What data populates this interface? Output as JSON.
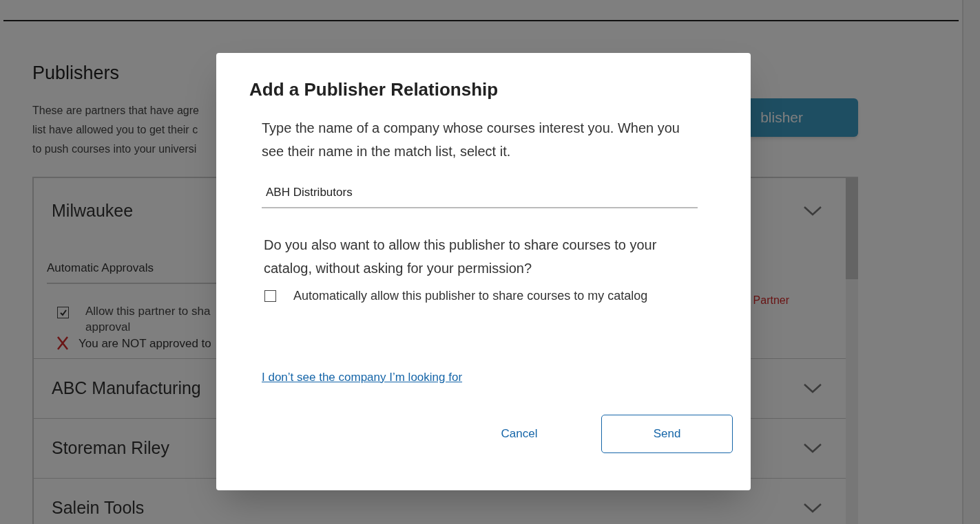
{
  "page": {
    "heading": "Publishers",
    "description_lines": [
      "These are partners that have agre",
      "list have allowed you to get their c",
      "to push courses into your universi"
    ],
    "add_button": "blisher",
    "publishers": [
      {
        "name": "Milwaukee",
        "expanded": true,
        "section_title": "Automatic Approvals",
        "option": {
          "label_lines": [
            "Allow this partner to sha",
            "approval"
          ],
          "checked": true
        },
        "status": {
          "text": "You are NOT approved to",
          "approved": false
        },
        "side_note": "Partner"
      },
      {
        "name": "ABC Manufacturing",
        "expanded": false
      },
      {
        "name": "Storeman Riley",
        "expanded": false
      },
      {
        "name": "Salein Tools",
        "expanded": false
      }
    ]
  },
  "dialog": {
    "title": "Add a Publisher Relationship",
    "instructions": "Type the name of a company whose courses interest you. When you see their name in the match list, select it.",
    "search": {
      "value": "ABH Distributors"
    },
    "question": "Do you also want to allow this publisher to share courses to your catalog, without asking for your permission?",
    "option": {
      "label": "Automatically allow this publisher to share courses to my catalog",
      "checked": false
    },
    "link": "I don’t see the company I’m looking for",
    "buttons": [
      {
        "label": "Cancel",
        "kind": "text"
      },
      {
        "label": "Send",
        "kind": "outlined"
      }
    ]
  }
}
